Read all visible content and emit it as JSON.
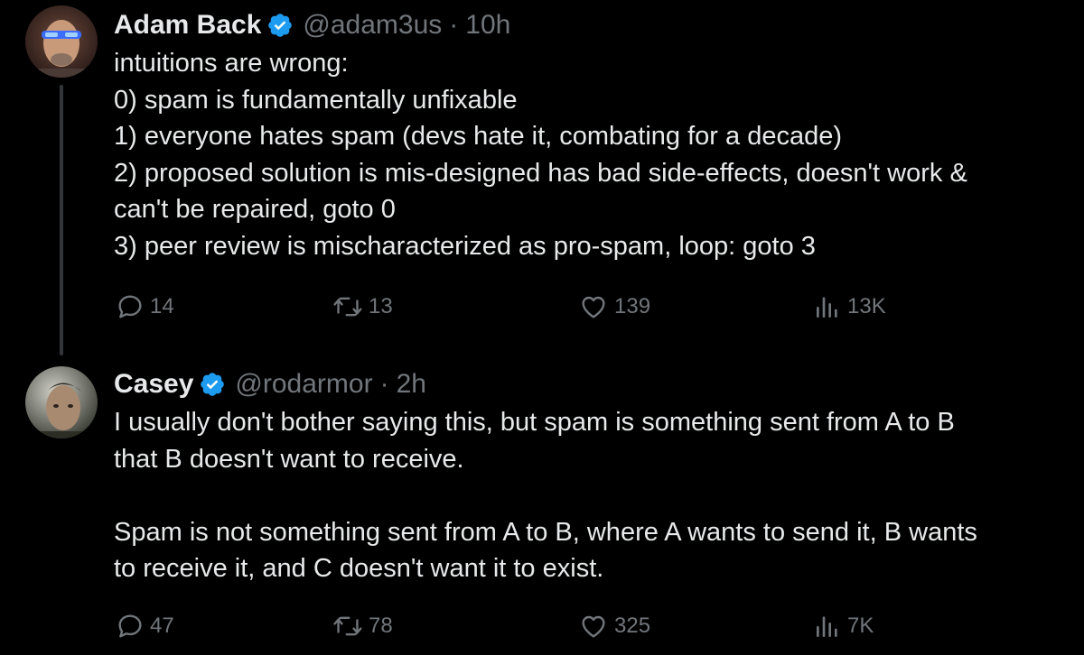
{
  "colors": {
    "background": "#000000",
    "text_primary": "#e7e9ea",
    "text_secondary": "#71767b",
    "verified_badge": "#1d9bf0",
    "thread_line": "#333639"
  },
  "tweets": [
    {
      "display_name": "Adam Back",
      "verified_icon": "verified-badge-icon",
      "handle": "@adam3us",
      "separator": "·",
      "time": "10h",
      "lines": [
        "intuitions are wrong:",
        "0) spam is fundamentally unfixable",
        "1) everyone hates spam (devs hate it, combating for a decade)",
        "2) proposed solution is mis-designed has bad side-effects, doesn't work &",
        "can't be repaired, goto 0",
        "3) peer review is mischaracterized as pro-spam, loop: goto 3"
      ],
      "stats": {
        "replies": "14",
        "reposts": "13",
        "likes": "139",
        "views": "13K"
      }
    },
    {
      "display_name": "Casey",
      "verified_icon": "verified-badge-icon",
      "handle": "@rodarmor",
      "separator": "·",
      "time": "2h",
      "lines": [
        "I usually don't bother saying this, but spam is something sent from A to B",
        "that B doesn't want to receive.",
        "",
        "Spam is not something sent from A to B, where A wants to send it, B wants",
        "to receive it, and C doesn't want it to exist."
      ],
      "stats": {
        "replies": "47",
        "reposts": "78",
        "likes": "325",
        "views": "7K"
      }
    }
  ],
  "icons": {
    "reply": "reply-icon",
    "repost": "repost-icon",
    "like": "heart-icon",
    "views": "views-chart-icon"
  }
}
